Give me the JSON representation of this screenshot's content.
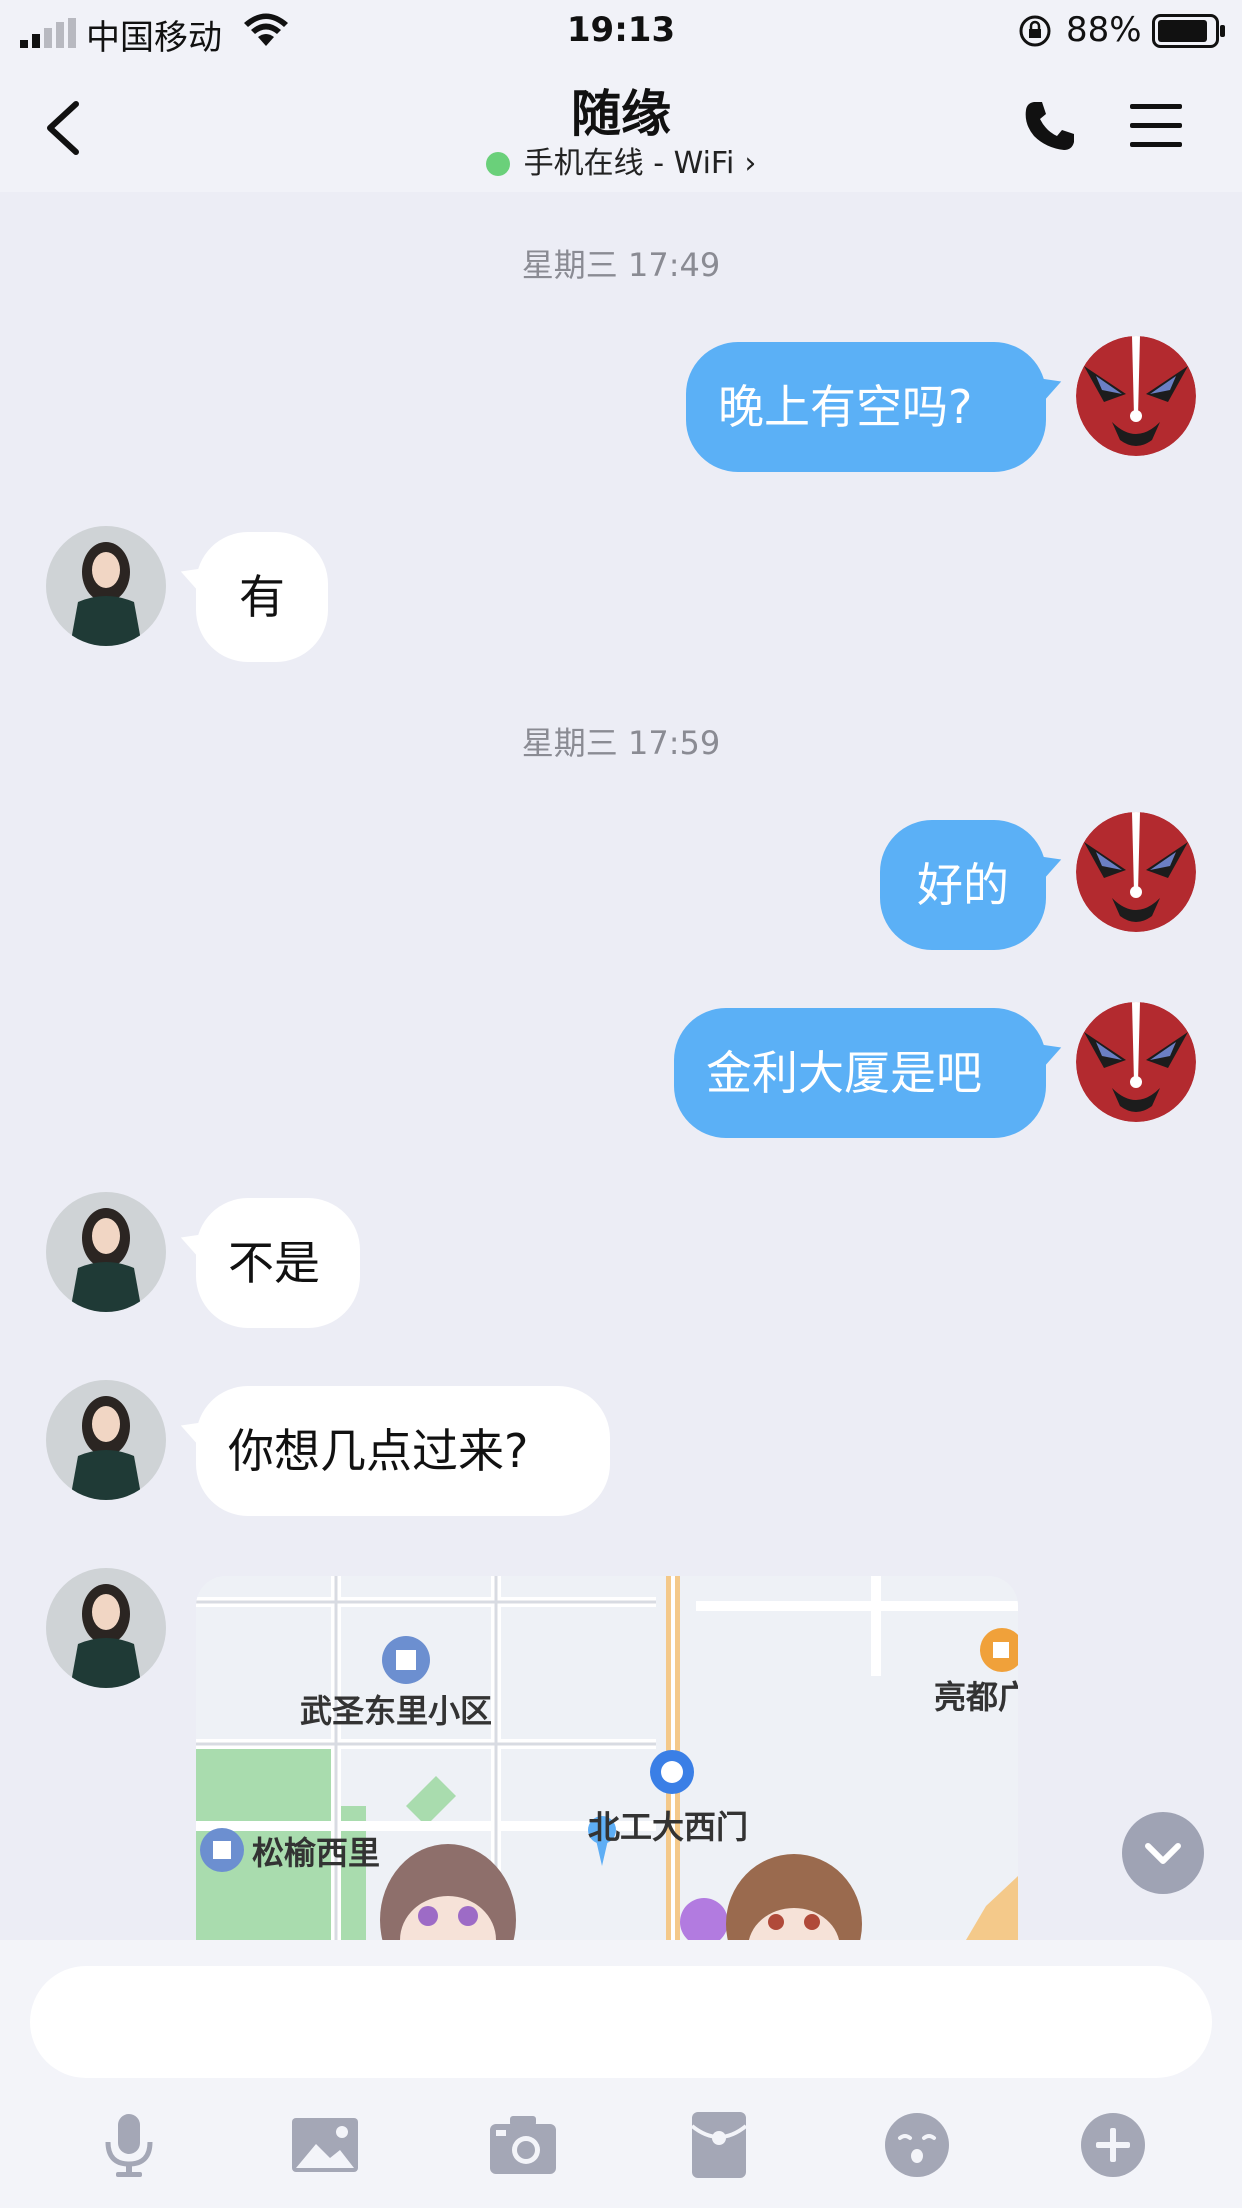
{
  "status_bar": {
    "carrier": "中国移动",
    "time": "19:13",
    "battery_percent": "88%",
    "battery_level": 0.88,
    "signal_bars_filled": 2
  },
  "header": {
    "title": "随缘",
    "status": "手机在线 - WiFi",
    "status_color": "#6ad07a"
  },
  "messages": [
    {
      "type": "timestamp",
      "text": "星期三 17:49"
    },
    {
      "sender": "me",
      "text": "晚上有空吗?"
    },
    {
      "sender": "them",
      "text": "有"
    },
    {
      "type": "timestamp",
      "text": "星期三 17:59"
    },
    {
      "sender": "me",
      "text": "好的"
    },
    {
      "sender": "me",
      "text": "金利大厦是吧"
    },
    {
      "sender": "them",
      "text": "不是"
    },
    {
      "sender": "them",
      "text": "你想几点过来?"
    },
    {
      "sender": "them",
      "type": "location-map"
    }
  ],
  "map": {
    "labels": [
      "武圣东里小区",
      "亮都广",
      "松榆西里",
      "北工大西门"
    ]
  },
  "input": {
    "placeholder": ""
  },
  "toolbar": {
    "icons": [
      "microphone-icon",
      "image-icon",
      "camera-icon",
      "red-packet-icon",
      "emoji-icon",
      "plus-icon"
    ]
  },
  "colors": {
    "my_bubble": "#5bb0f6",
    "their_bubble": "#ffffff",
    "background": "#ecedf5"
  }
}
